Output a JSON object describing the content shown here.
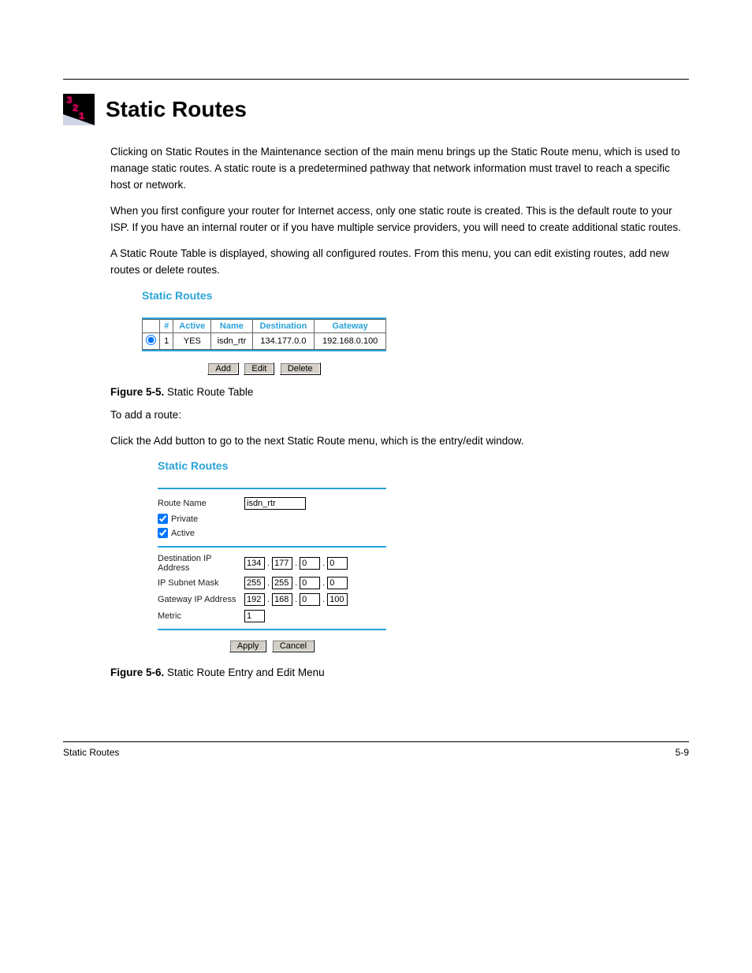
{
  "header": {
    "title": "Static Routes"
  },
  "intro": {
    "p1": "Clicking on Static Routes in the Maintenance section of the main menu brings up the Static Route menu, which is used to manage static routes. A static route is a predetermined pathway that network information must travel to reach a specific host or network.",
    "p2": "When you first configure your router for Internet access, only one static route is created. This is the default route to your ISP. If you have an internal router or if you have multiple service providers, you will need to create additional static routes.",
    "p3": "A Static Route Table is displayed, showing all configured routes. From this menu, you can edit existing routes, add new routes or delete routes."
  },
  "figure1": {
    "title": "Static Routes",
    "headers": {
      "hash": "#",
      "active": "Active",
      "name": "Name",
      "dest": "Destination",
      "gw": "Gateway"
    },
    "row": {
      "n": "1",
      "active": "YES",
      "name": "isdn_rtr",
      "dest": "134.177.0.0",
      "gw": "192.168.0.100"
    },
    "buttons": {
      "add": "Add",
      "edit": "Edit",
      "delete": "Delete"
    }
  },
  "caption1_prefix": "Figure 5-5.",
  "caption1_text": "Static Route Table",
  "middle1": "To add a route:",
  "middle2": "Click the Add button to go to the next Static Route menu, which is the entry/edit window.",
  "figure2": {
    "title": "Static Routes",
    "labels": {
      "route_name": "Route Name",
      "private": "Private",
      "active": "Active",
      "dest": "Destination IP Address",
      "mask": "IP Subnet Mask",
      "gw": "Gateway IP Address",
      "metric": "Metric"
    },
    "values": {
      "route_name": "isdn_rtr",
      "private_checked": true,
      "active_checked": true,
      "dest": [
        "134",
        "177",
        "0",
        "0"
      ],
      "mask": [
        "255",
        "255",
        "0",
        "0"
      ],
      "gw": [
        "192",
        "168",
        "0",
        "100"
      ],
      "metric": "1"
    },
    "buttons": {
      "apply": "Apply",
      "cancel": "Cancel"
    }
  },
  "caption2_prefix": "Figure 5-6.",
  "caption2_text": "Static Route Entry and Edit Menu",
  "footer": {
    "left": "Static Routes",
    "right": "5-9"
  }
}
